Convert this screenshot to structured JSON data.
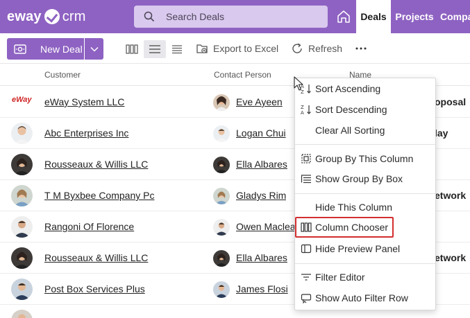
{
  "header": {
    "logo_left": "eway",
    "logo_right": "crm",
    "search_placeholder": "Search Deals",
    "tabs": [
      {
        "label": "Deals",
        "active": true
      },
      {
        "label": "Projects",
        "active": false
      },
      {
        "label": "Companies",
        "active": false
      }
    ]
  },
  "toolbar": {
    "new_deal_label": "New Deal",
    "export_label": "Export to Excel",
    "refresh_label": "Refresh",
    "more_label": "···"
  },
  "grid": {
    "columns": [
      "Customer",
      "Contact Person",
      "Name"
    ],
    "rows": [
      {
        "customer": "eWay System LLC",
        "customer_logo": "eWay",
        "contact": "Eve Ayeen",
        "name": "oposal"
      },
      {
        "customer": "Abc Enterprises Inc",
        "contact": "Logan Chui",
        "name": "lay"
      },
      {
        "customer": "Rousseaux & Willis LLC",
        "contact": "Ella Albares",
        "name": ""
      },
      {
        "customer": "T M Byxbee Company Pc",
        "contact": "Gladys Rim",
        "name": "etwork"
      },
      {
        "customer": "Rangoni Of Florence",
        "contact": "Owen Maclea",
        "name": ""
      },
      {
        "customer": "Rousseaux & Willis LLC",
        "contact": "Ella Albares",
        "name": "etwork"
      },
      {
        "customer": "Post Box Services Plus",
        "contact": "James Flosi",
        "name": ""
      }
    ]
  },
  "context_menu": {
    "items": [
      {
        "label": "Sort Ascending",
        "icon": "sort-ascending-icon"
      },
      {
        "label": "Sort Descending",
        "icon": "sort-descending-icon"
      },
      {
        "label": "Clear All Sorting",
        "icon": ""
      },
      {
        "label": "Group By This Column",
        "icon": "group-by-icon"
      },
      {
        "label": "Show Group By Box",
        "icon": "group-box-icon"
      },
      {
        "label": "Hide This Column",
        "icon": ""
      },
      {
        "label": "Column Chooser",
        "icon": "column-chooser-icon"
      },
      {
        "label": "Hide Preview Panel",
        "icon": "preview-panel-icon"
      },
      {
        "label": "Filter Editor",
        "icon": "filter-icon"
      },
      {
        "label": "Show Auto Filter Row",
        "icon": "auto-filter-icon"
      }
    ]
  },
  "colors": {
    "brand": "#8e62c2",
    "search_bg": "#d9c9ee",
    "highlight": "#d32f2f"
  }
}
